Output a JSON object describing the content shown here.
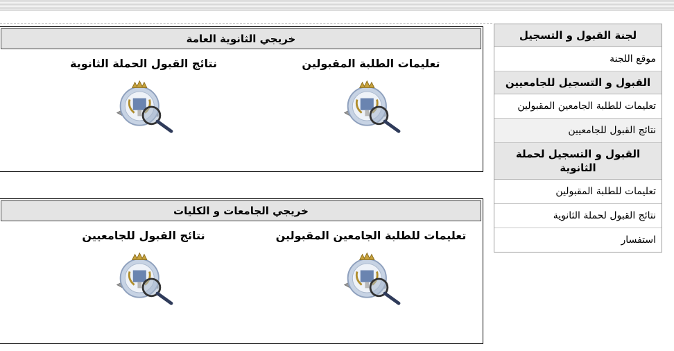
{
  "colors": {
    "title_bg": "#e4e4e4",
    "sidebar_header_bg": "#e6e6e6",
    "border": "#000000"
  },
  "icons": {
    "tile_emblem": "emblem-magnifier-icon"
  },
  "panels": [
    {
      "title": "خريجي الثانوية العامة",
      "tiles": [
        {
          "label": "تعليمات الطلبة المقبولين"
        },
        {
          "label": "نتائج القبول الحملة الثانوية"
        }
      ]
    },
    {
      "title": "خريجي الجامعات و الكليات",
      "tiles": [
        {
          "label": "تعليمات للطلبة الجامعين المقبولين"
        },
        {
          "label": "نتائج القبول للجامعيين"
        }
      ]
    }
  ],
  "sidebar": {
    "section1": {
      "header": "لجنة القبول و التسجيل",
      "items": [
        "موقع اللجنة"
      ]
    },
    "section2": {
      "header": "القبول و التسجيل للجامعيين",
      "items": [
        "تعليمات للطلبة الجامعين المقبولين",
        "نتائج القبول للجامعيين"
      ]
    },
    "section3": {
      "header": "القبول و التسجيل لحملة الثانوية",
      "items": [
        "تعليمات للطلبة المقبولين",
        "نتائج القبول لحملة الثانوية",
        "استفسار"
      ]
    }
  }
}
